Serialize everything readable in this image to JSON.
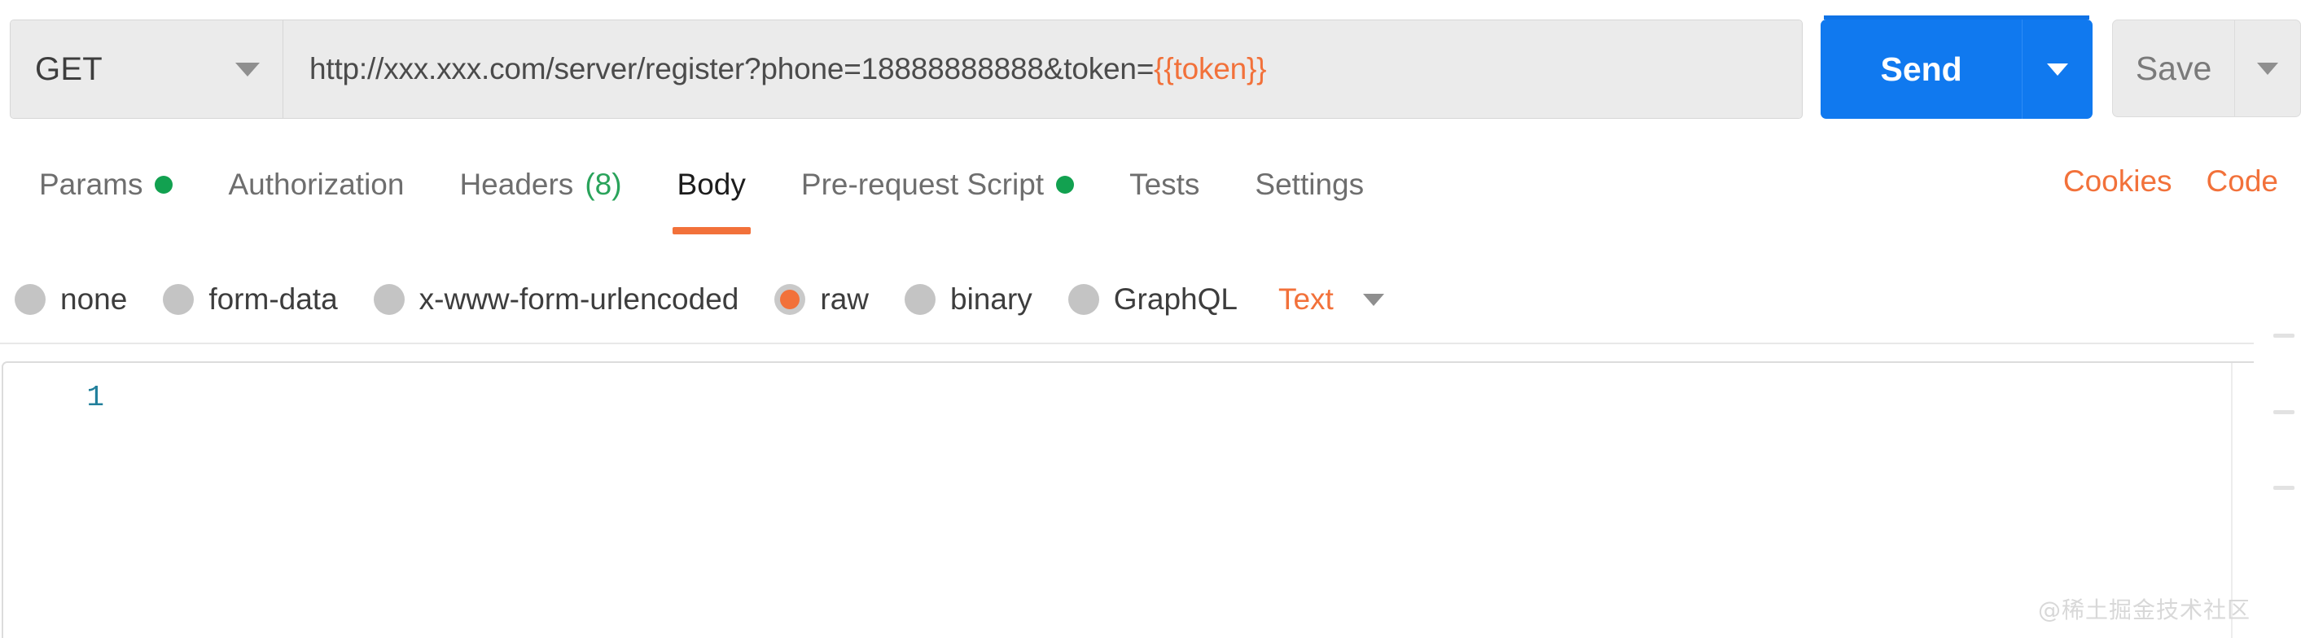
{
  "request_bar": {
    "method": "GET",
    "url_prefix": "http://xxx.xxx.com/server/register?phone=18888888888&token=",
    "url_variable": "{{token}}",
    "full_url": "http://xxx.xxx.com/server/register?phone=18888888888&token={{token}}",
    "send_label": "Send",
    "save_label": "Save"
  },
  "tabs": [
    {
      "label": "Params",
      "indicator": "dot",
      "active": false
    },
    {
      "label": "Authorization",
      "indicator": "none",
      "active": false
    },
    {
      "label": "Headers",
      "indicator": "count",
      "count": "(8)",
      "active": false
    },
    {
      "label": "Body",
      "indicator": "none",
      "active": true
    },
    {
      "label": "Pre-request Script",
      "indicator": "dot",
      "active": false
    },
    {
      "label": "Tests",
      "indicator": "none",
      "active": false
    },
    {
      "label": "Settings",
      "indicator": "none",
      "active": false
    }
  ],
  "tab_actions": [
    {
      "label": "Cookies"
    },
    {
      "label": "Code"
    }
  ],
  "body_types": [
    {
      "label": "none",
      "selected": false
    },
    {
      "label": "form-data",
      "selected": false
    },
    {
      "label": "x-www-form-urlencoded",
      "selected": false
    },
    {
      "label": "raw",
      "selected": true
    },
    {
      "label": "binary",
      "selected": false
    },
    {
      "label": "GraphQL",
      "selected": false
    }
  ],
  "body_format": {
    "selected": "Text"
  },
  "editor": {
    "line_numbers": [
      "1"
    ],
    "content": "",
    "placeholder": ""
  },
  "watermark": {
    "text": "@稀土掘金技术社区"
  },
  "colors": {
    "accent_orange": "#f2713a",
    "send_blue": "#1079ef",
    "indicator_green": "#12a150",
    "count_green": "#2aa35b",
    "line_number_teal": "#22809c",
    "field_bg": "#ebebeb"
  }
}
